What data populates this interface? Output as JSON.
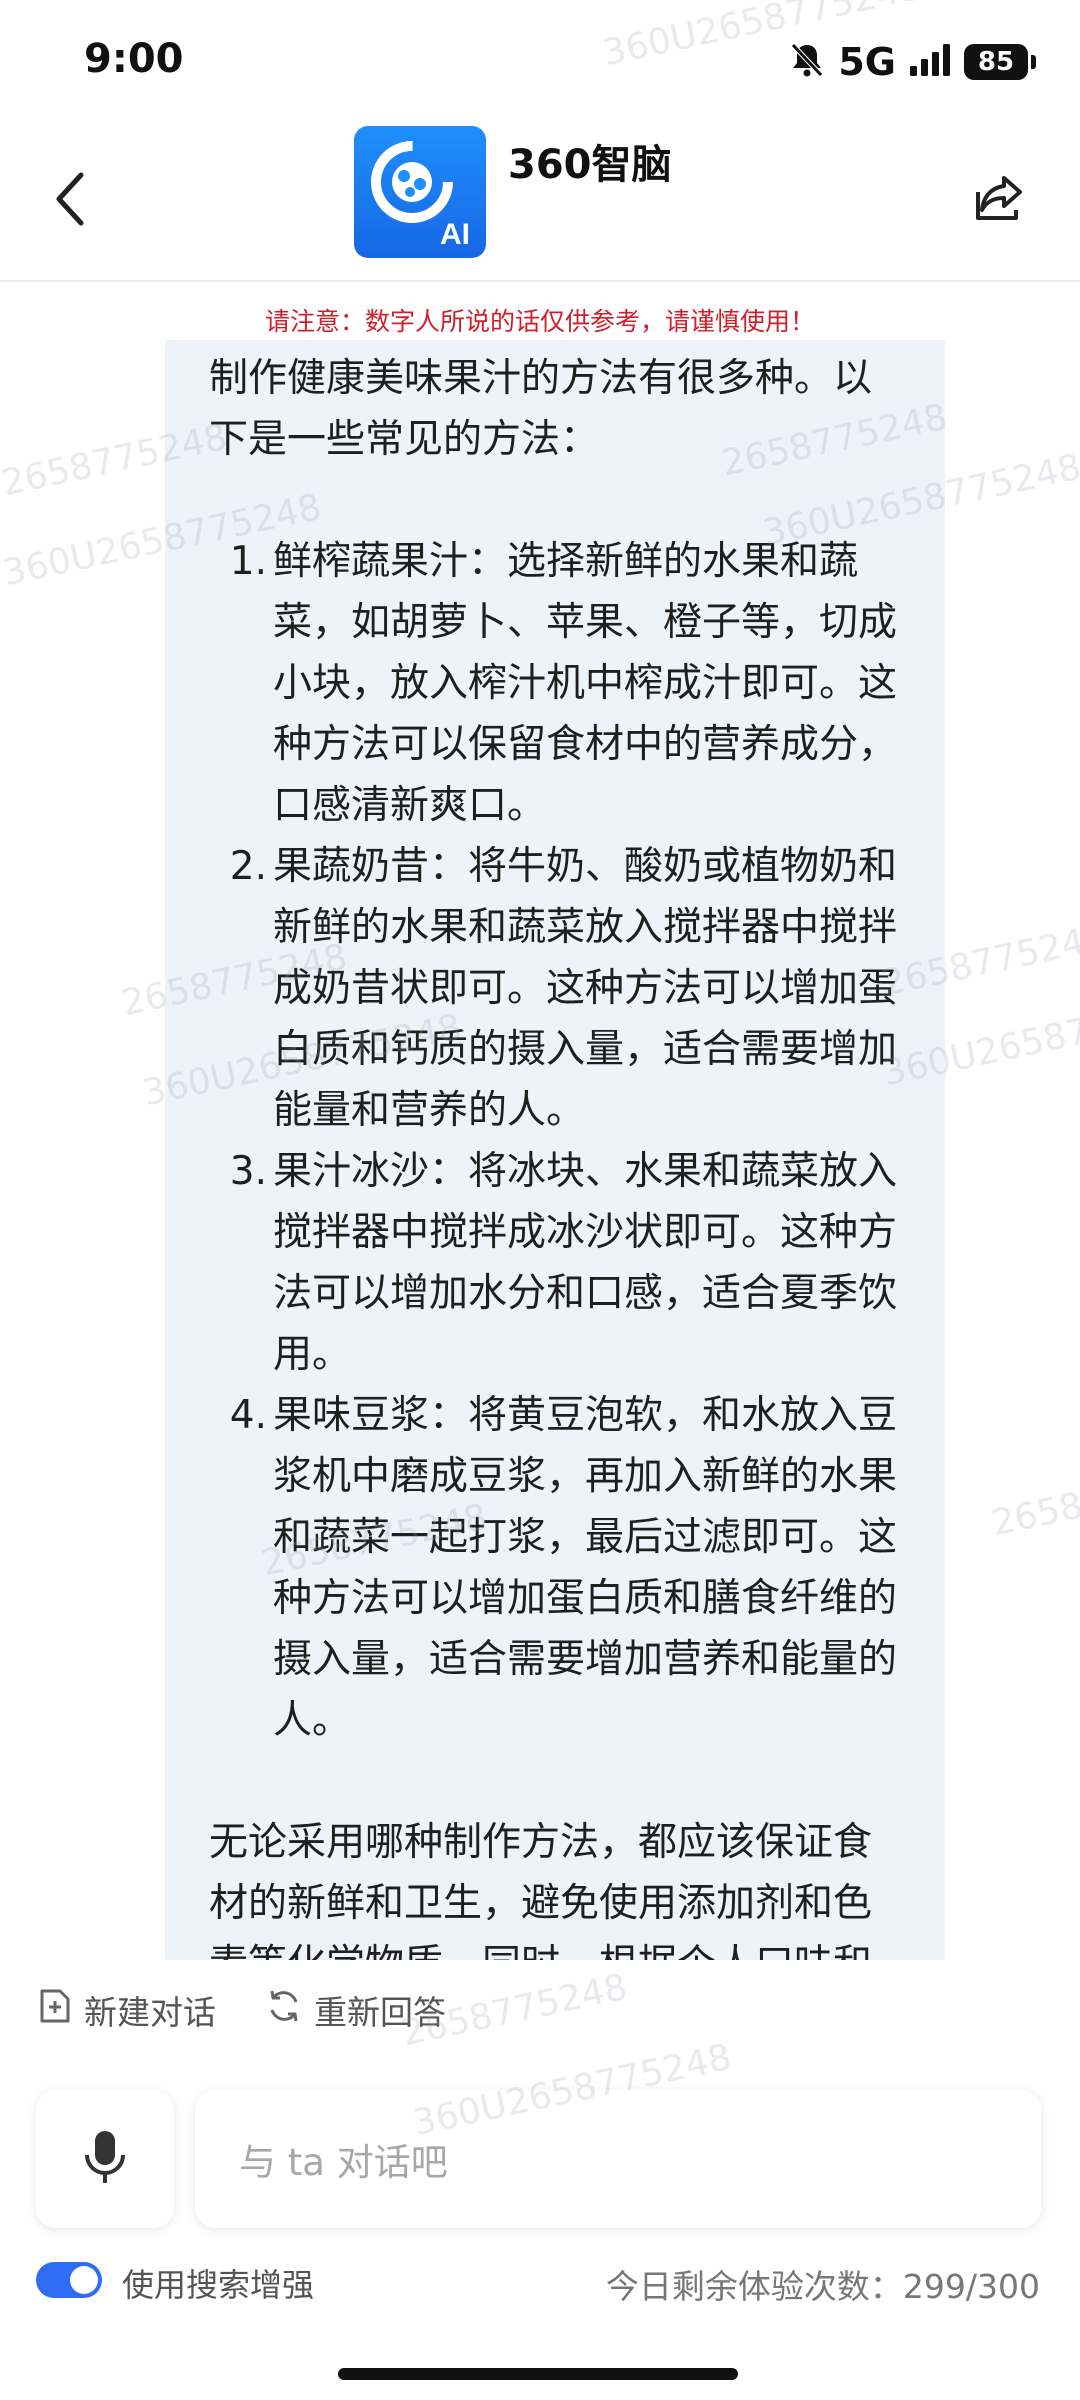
{
  "status_bar": {
    "time": "9:00",
    "network": "5G",
    "battery": "85"
  },
  "header": {
    "title": "360智脑",
    "logo_badge": "AI",
    "back_icon": "chevron-left-icon",
    "share_icon": "share-icon"
  },
  "notice": "请注意：数字人所说的话仅供参考，请谨慎使用！",
  "answer": {
    "intro": "制作健康美味果汁的方法有很多种。以下是一些常见的方法：",
    "steps": [
      {
        "num": "1.",
        "text": "鲜榨蔬果汁：选择新鲜的水果和蔬菜，如胡萝卜、苹果、橙子等，切成小块，放入榨汁机中榨成汁即可。这种方法可以保留食材中的营养成分，口感清新爽口。"
      },
      {
        "num": "2.",
        "text": "果蔬奶昔：将牛奶、酸奶或植物奶和新鲜的水果和蔬菜放入搅拌器中搅拌成奶昔状即可。这种方法可以增加蛋白质和钙质的摄入量，适合需要增加能量和营养的人。"
      },
      {
        "num": "3.",
        "text": "果汁冰沙：将冰块、水果和蔬菜放入搅拌器中搅拌成冰沙状即可。这种方法可以增加水分和口感，适合夏季饮用。"
      },
      {
        "num": "4.",
        "text": "果味豆浆：将黄豆泡软，和水放入豆浆机中磨成豆浆，再加入新鲜的水果和蔬菜一起打浆，最后过滤即可。这种方法可以增加蛋白质和膳食纤维的摄入量，适合需要增加营养和能量的人。"
      }
    ],
    "conclusion": "无论采用哪种制作方法，都应该保证食材的新鲜和卫生，避免使用添加剂和色素等化学物质。同时，根据个人口味和"
  },
  "actions": {
    "new_chat": "新建对话",
    "regenerate": "重新回答"
  },
  "input": {
    "placeholder": "与 ta 对话吧"
  },
  "footer": {
    "search_boost_label": "使用搜索增强",
    "search_boost_on": true,
    "usage_label": "今日剩余体验次数：299/300"
  },
  "watermark": {
    "line1": "2658775248",
    "line2": "360U2658775248"
  },
  "colors": {
    "accent": "#2f6cf6",
    "notice": "#d01f2a",
    "card_bg": "#eef3fa"
  }
}
